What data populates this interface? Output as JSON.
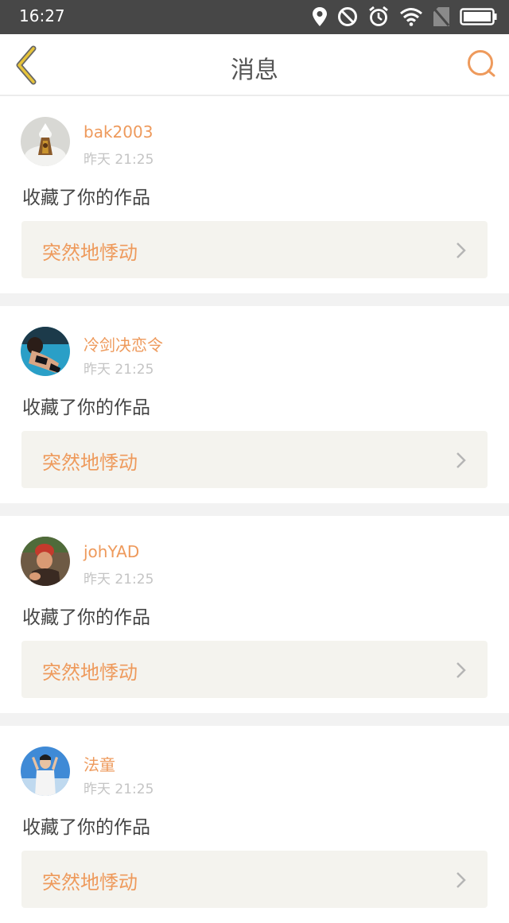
{
  "status_bar": {
    "time": "16:27",
    "icons": [
      "location-icon",
      "do-not-disturb-icon",
      "alarm-icon",
      "wifi-icon",
      "no-sim-icon",
      "battery-icon"
    ]
  },
  "header": {
    "title": "消息",
    "back_icon": "back-chevron-icon",
    "search_icon": "search-icon"
  },
  "colors": {
    "accent": "#ee9a5c",
    "back_icon": "#e6c33a",
    "card_link_bg": "#f4f3ee"
  },
  "messages": [
    {
      "username": "bak2003",
      "time": "昨天 21:25",
      "action": "收藏了你的作品",
      "work_title": "突然地悸动",
      "avatar": "avatar-bak2003"
    },
    {
      "username": "冷剑决恋令",
      "time": "昨天 21:25",
      "action": "收藏了你的作品",
      "work_title": "突然地悸动",
      "avatar": "avatar-lengjian"
    },
    {
      "username": "johYAD",
      "time": "昨天 21:25",
      "action": "收藏了你的作品",
      "work_title": "突然地悸动",
      "avatar": "avatar-johyad"
    },
    {
      "username": "法童",
      "time": "昨天 21:25",
      "action": "收藏了你的作品",
      "work_title": "突然地悸动",
      "avatar": "avatar-fatong"
    }
  ]
}
